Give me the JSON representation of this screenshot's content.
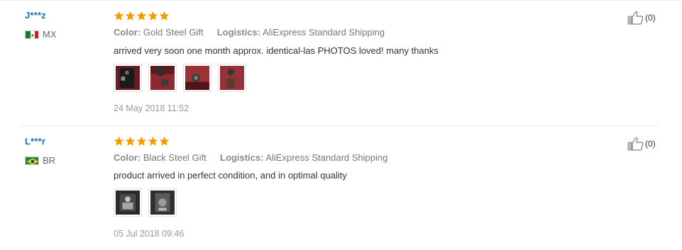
{
  "reviews": [
    {
      "user": "J***z",
      "country_code": "MX",
      "rating_stars": 5,
      "color_label": "Color:",
      "color_value": "Gold Steel Gift",
      "logistics_label": "Logistics:",
      "logistics_value": "AliExpress Standard Shipping",
      "feedback": "arrived very soon one month approx. identical-las PHOTOS loved! many thanks",
      "photo_count": 4,
      "date": "24 May 2018 11:52",
      "helpful_count": "(0)",
      "icons": {
        "flag": "mexico-flag-icon",
        "helpful": "thumbs-up-icon",
        "star": "star-icon"
      }
    },
    {
      "user": "L***r",
      "country_code": "BR",
      "rating_stars": 5,
      "color_label": "Color:",
      "color_value": "Black Steel Gift",
      "logistics_label": "Logistics:",
      "logistics_value": "AliExpress Standard Shipping",
      "feedback": "product arrived in perfect condition, and in optimal quality",
      "photo_count": 2,
      "date": "05 Jul 2018 09:46",
      "helpful_count": "(0)",
      "icons": {
        "flag": "brazil-flag-icon",
        "helpful": "thumbs-up-icon",
        "star": "star-icon"
      }
    }
  ],
  "colors": {
    "star": "#f59b00",
    "username": "#1f6fb5",
    "text": "#333333",
    "muted": "#999999"
  }
}
